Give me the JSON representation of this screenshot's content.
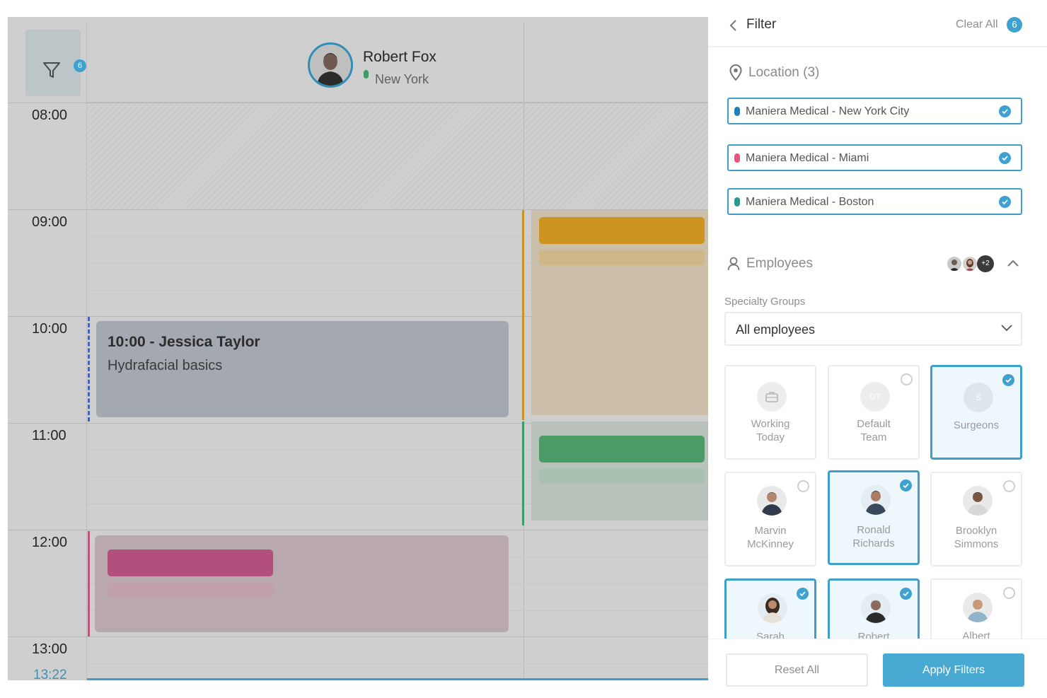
{
  "calendar": {
    "filter_badge": "6",
    "employee": {
      "name": "Robert Fox",
      "location": "New York"
    },
    "hours": [
      "08:00",
      "09:00",
      "10:00",
      "11:00",
      "12:00",
      "13:00"
    ],
    "current_time": "13:22",
    "appointment": {
      "title": "10:00 - Jessica Taylor",
      "service": "Hydrafacial basics"
    },
    "colors": {
      "orange": "#cd9520",
      "green": "#4b9b66",
      "pink": "#b24f7c",
      "blue_border": "#4860b2"
    }
  },
  "panel": {
    "title": "Filter",
    "clear_all": "Clear All",
    "clear_count": "6",
    "location": {
      "title": "Location (3)",
      "items": [
        {
          "label": "Maniera Medical - New York City",
          "color": "#1f7fbf",
          "checked": true
        },
        {
          "label": "Maniera Medical - Miami",
          "color": "#e7557f",
          "checked": true
        },
        {
          "label": "Maniera Medical - Boston",
          "color": "#2a9a8e",
          "checked": true
        }
      ]
    },
    "employees": {
      "title": "Employees",
      "more": "+2",
      "specialty_label": "Specialty Groups",
      "specialty_value": "All employees",
      "cards": [
        {
          "label": "Working Today",
          "selected": false
        },
        {
          "label": "Default Team",
          "initials": "DT",
          "selected": false
        },
        {
          "label": "Surgeons",
          "initials": "S",
          "selected": true
        },
        {
          "label": "Marvin McKinney",
          "selected": false
        },
        {
          "label": "Ronald Richards",
          "selected": true
        },
        {
          "label": "Brooklyn Simmons",
          "selected": false
        },
        {
          "label": "Sarah",
          "selected": true
        },
        {
          "label": "Robert Fox",
          "selected": true
        },
        {
          "label": "Albert",
          "selected": false
        }
      ]
    },
    "reset_label": "Reset All",
    "apply_label": "Apply Filters",
    "accent": "#3ea1cf"
  }
}
